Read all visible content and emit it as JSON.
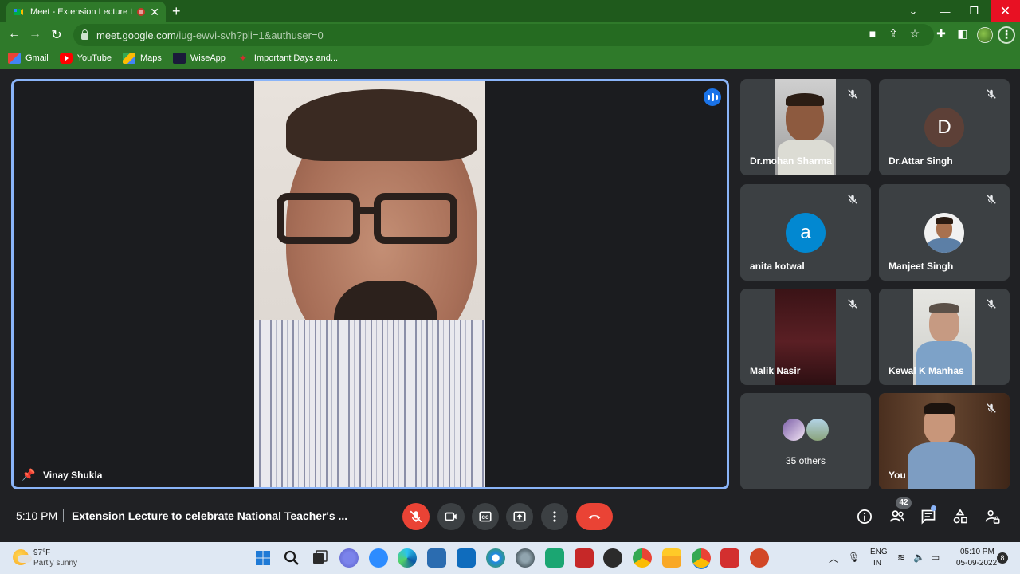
{
  "browser": {
    "tab_title": "Meet - Extension Lecture to c",
    "new_tab": "+",
    "url_host": "meet.google.com",
    "url_path": "/iug-ewvi-svh?pli=1&authuser=0",
    "bookmarks": [
      {
        "label": "Gmail",
        "icon": "gmail-icon"
      },
      {
        "label": "YouTube",
        "icon": "youtube-icon"
      },
      {
        "label": "Maps",
        "icon": "maps-icon"
      },
      {
        "label": "WiseApp",
        "icon": "wiseapp-icon"
      },
      {
        "label": "Important Days and...",
        "icon": "bookmark-page-icon"
      }
    ],
    "accent": "#2f7a2a"
  },
  "meet": {
    "main_speaker": "Vinay Shukla",
    "participants": [
      {
        "name": "Dr.mohan Sharma",
        "type": "video"
      },
      {
        "name": "Dr.Attar Singh",
        "initial": "D",
        "avatar_color": "#5d4037",
        "type": "initial"
      },
      {
        "name": "anita kotwal",
        "initial": "a",
        "avatar_color": "#0288d1",
        "type": "initial"
      },
      {
        "name": "Manjeet Singh",
        "type": "photo"
      },
      {
        "name": "Malik Nasir",
        "type": "video"
      },
      {
        "name": "Kewal K Manhas",
        "type": "video"
      }
    ],
    "others_label": "35 others",
    "self_label": "You",
    "clock": "5:10 PM",
    "meeting_title": "Extension Lecture to celebrate National Teacher's ...",
    "people_count": "42",
    "colors": {
      "active_border": "#8ab4f8",
      "end_call": "#ea4335",
      "tile_bg": "#3c4043"
    }
  },
  "taskbar": {
    "weather_temp": "97°F",
    "weather_desc": "Partly sunny",
    "lang_top": "ENG",
    "lang_bottom": "IN",
    "time": "05:10 PM",
    "date": "05-09-2022",
    "notification_count": "8"
  }
}
